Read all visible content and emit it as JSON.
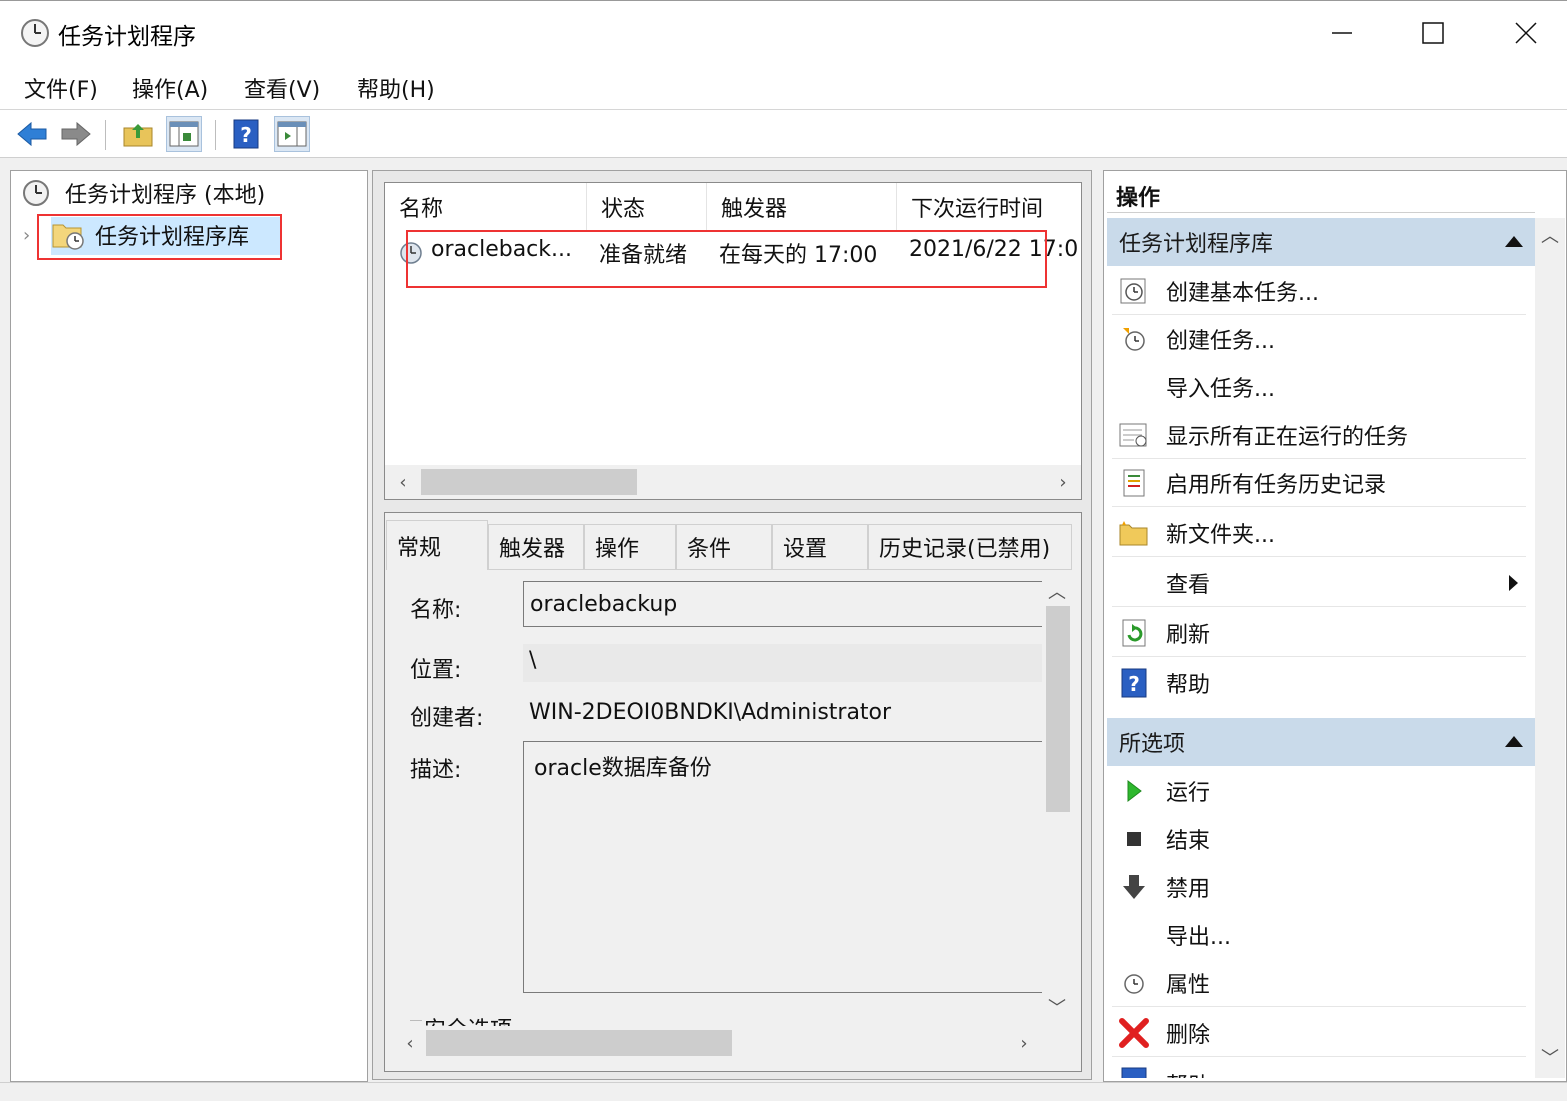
{
  "window": {
    "title": "任务计划程序"
  },
  "menu": [
    "文件(F)",
    "操作(A)",
    "查看(V)",
    "帮助(H)"
  ],
  "tree": {
    "root": "任务计划程序 (本地)",
    "library": "任务计划程序库"
  },
  "task_list": {
    "columns": [
      "名称",
      "状态",
      "触发器",
      "下次运行时间"
    ],
    "rows": [
      {
        "name": "oracleback...",
        "status": "准备就绪",
        "trigger": "在每天的 17:00",
        "next_run": "2021/6/22 17:0"
      }
    ]
  },
  "detail": {
    "tabs": [
      "常规",
      "触发器",
      "操作",
      "条件",
      "设置",
      "历史记录(已禁用)"
    ],
    "name_label": "名称:",
    "name_value": "oraclebackup",
    "location_label": "位置:",
    "location_value": "\\",
    "author_label": "创建者:",
    "author_value": "WIN-2DEOI0BNDKI\\Administrator",
    "desc_label": "描述:",
    "desc_value": "oracle数据库备份",
    "security_label": "安全选项"
  },
  "actions": {
    "title": "操作",
    "section1": "任务计划程序库",
    "items1": [
      "创建基本任务...",
      "创建任务...",
      "导入任务...",
      "显示所有正在运行的任务",
      "启用所有任务历史记录",
      "新文件夹...",
      "查看",
      "刷新",
      "帮助"
    ],
    "section2": "所选项",
    "items2": [
      "运行",
      "结束",
      "禁用",
      "导出...",
      "属性",
      "删除",
      "帮助"
    ]
  },
  "colors": {
    "section_bg": "#c9daea",
    "selected_bg": "#cce8ff",
    "highlight_border": "#e33333"
  }
}
